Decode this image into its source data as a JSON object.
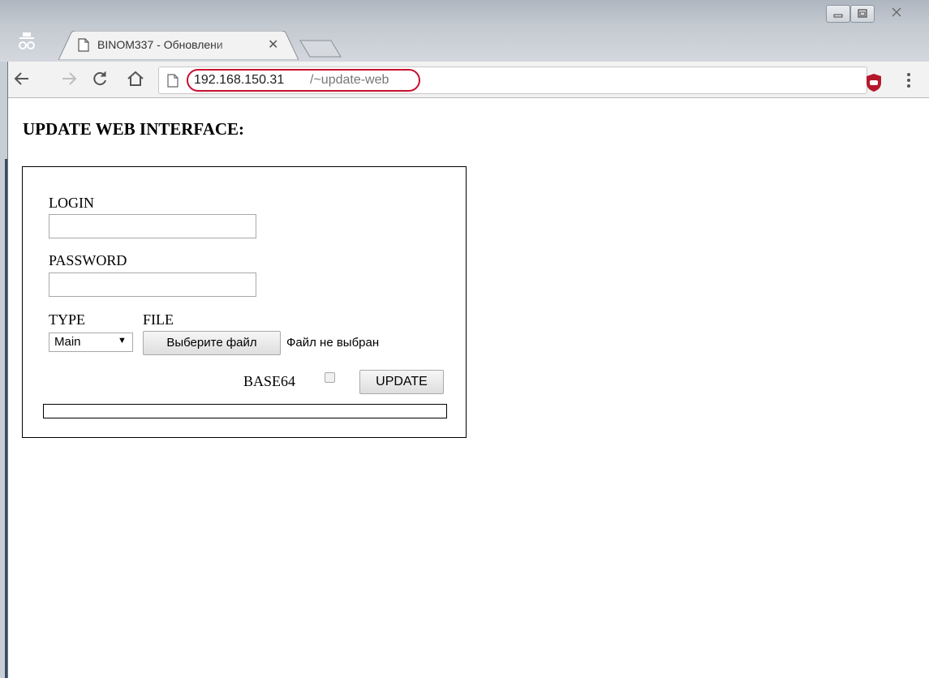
{
  "browser": {
    "tab_title": "BINOM337 - Обновлени",
    "tab_close": "✕",
    "url_host": "192.168.150.31",
    "url_path": "/~update-web"
  },
  "page": {
    "heading": "UPDATE WEB INTERFACE:",
    "login_label": "LOGIN",
    "login_value": "",
    "password_label": "PASSWORD",
    "password_value": "",
    "type_label": "TYPE",
    "type_selected": "Main",
    "file_label": "FILE",
    "file_button": "Выберите файл",
    "file_status": "Файл не выбран",
    "base64_label": "BASE64",
    "base64_checked": false,
    "update_button": "UPDATE",
    "progress": 0
  },
  "colors": {
    "url_highlight": "#c8102e",
    "ublock": "#b5172b"
  }
}
